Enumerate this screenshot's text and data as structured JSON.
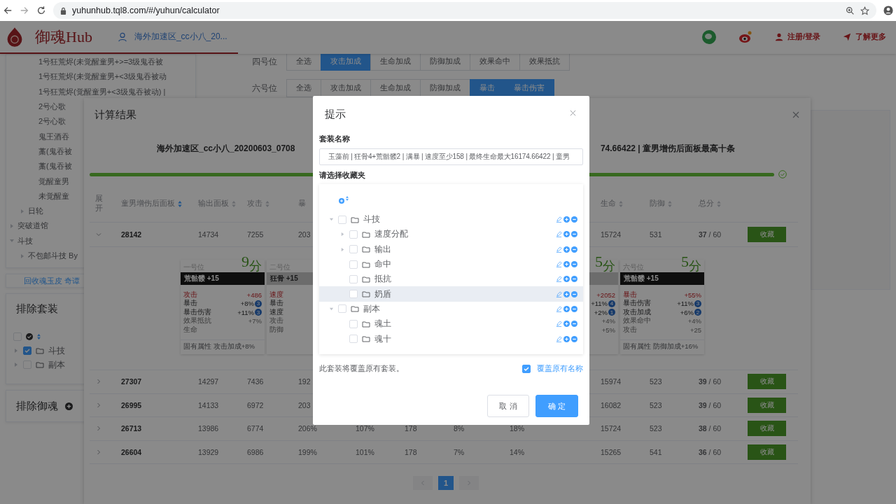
{
  "browser": {
    "url": "yuhunhub.tql8.com/#/yuhun/calculator"
  },
  "header": {
    "brand": "御魂Hub",
    "user": "海外加速区_cc小八_20...",
    "links": [
      {
        "kind": "wechat"
      },
      {
        "kind": "weibo"
      },
      {
        "kind": "user",
        "label": "注册/登录"
      },
      {
        "kind": "send",
        "label": "了解更多"
      }
    ]
  },
  "sidebar": {
    "tree": [
      {
        "children": [
          {
            "children": [
              {
                "label": "1号狂荒烬(未觉醒童男+>=3级鬼吞被"
              },
              {
                "label": "1号狂荒烬(未觉醒童男+<3级鬼吞被动"
              },
              {
                "label": "1号狂荒烬(觉醒童男+<3级鬼吞被动) |"
              },
              {
                "label": "2号心歌"
              },
              {
                "label": "2号心歌"
              },
              {
                "label": "鬼王酒吞"
              },
              {
                "label": "藁(鬼吞被"
              },
              {
                "label": "藁(鬼吞被"
              },
              {
                "label": "觉醒童男"
              },
              {
                "label": "未觉醒童"
              }
            ]
          },
          {
            "label": "日轮",
            "expanded": false
          }
        ]
      },
      {
        "label": "突破道馆",
        "expanded": false
      },
      {
        "label": "斗技",
        "expanded": true,
        "children": [
          {
            "label": "不包邮斗技 By",
            "expanded": false
          }
        ]
      }
    ],
    "link": "回收魂玉皮 奇谭",
    "exclude_sets": {
      "title": "排除套装",
      "all_checked": false,
      "folders": [
        {
          "label": "斗技",
          "checked": true
        },
        {
          "label": "副本",
          "checked": false
        }
      ]
    },
    "exclude_yuhun": {
      "title": "排除御魂"
    }
  },
  "filters": [
    {
      "label": "四号位",
      "options": [
        {
          "label": "全选",
          "selected": false
        },
        {
          "label": "攻击加成",
          "selected": true
        },
        {
          "label": "生命加成",
          "selected": false
        },
        {
          "label": "防御加成",
          "selected": false
        },
        {
          "label": "效果命中",
          "selected": false
        },
        {
          "label": "效果抵抗",
          "selected": false
        }
      ]
    },
    {
      "label": "六号位",
      "options": [
        {
          "label": "全选",
          "selected": false
        },
        {
          "label": "攻击加成",
          "selected": false
        },
        {
          "label": "生命加成",
          "selected": false
        },
        {
          "label": "防御加成",
          "selected": false
        },
        {
          "label": "暴击",
          "selected": true
        },
        {
          "label": "暴击伤害",
          "selected": true
        }
      ]
    }
  ],
  "result": {
    "title": "计算结果",
    "heading_left": "海外加速区_cc小八_20200603_0708",
    "heading_right": "74.66422 | 童男增伤后面板最高十条",
    "progress": {
      "level": 1
    },
    "columns": [
      {
        "label": "展开"
      },
      {
        "label": "童男增伤后面板",
        "sorted": true
      },
      {
        "label": "输出面板",
        "sorted": false
      },
      {
        "label": "攻击",
        "sorted": false
      },
      {
        "label": "暴"
      },
      null,
      null,
      null,
      null,
      {
        "label": "生命",
        "sorted": false
      },
      {
        "label": "防御",
        "sorted": false
      },
      {
        "label": "总分",
        "sorted": false
      },
      null
    ],
    "rows": [
      {
        "expanded": true,
        "cells": [
          null,
          "28142",
          "14734",
          "7255",
          "203",
          null,
          null,
          null,
          null,
          "15724",
          "531",
          "**37** / 60"
        ],
        "action": "收藏"
      },
      {
        "expanded": false,
        "cells": [
          null,
          "27307",
          "14297",
          "7436",
          "192",
          null,
          null,
          null,
          null,
          "15974",
          "523",
          "**39** / 60"
        ],
        "action": "收藏"
      },
      {
        "expanded": false,
        "cells": [
          null,
          "26995",
          "14133",
          "6972",
          "203",
          null,
          null,
          null,
          null,
          "16082",
          "523",
          "**39** / 60"
        ],
        "action": "收藏"
      },
      {
        "expanded": false,
        "cells": [
          null,
          "26713",
          "13986",
          "6774",
          "206%",
          "107%",
          "178",
          "8%",
          "18%",
          "15724",
          "523",
          "**38** / 60"
        ],
        "action": "收藏"
      },
      {
        "expanded": false,
        "cells": [
          null,
          "26604",
          "13929",
          "6986",
          "199%",
          "101%",
          "178",
          "7%",
          "14%",
          "15265",
          "541",
          "**36** / 60"
        ],
        "action": "收藏"
      }
    ],
    "cards_left": [
      {
        "slot": "一号位",
        "score": "9$_{分}$",
        "name": "荒骷髅 +15",
        "dark": true,
        "stats": [
          {
            "kind": "main",
            "label": "攻击",
            "value": "+486"
          },
          {
            "kind": "sub",
            "label": "暴击",
            "value": "+8%",
            "badge": "3"
          },
          {
            "kind": "sub",
            "label": "暴击伤害",
            "value": "+11%",
            "badge": "3"
          },
          {
            "kind": "faded",
            "label": "效果抵抗",
            "value": "+7%"
          },
          {
            "kind": "faded",
            "label": "生命"
          }
        ],
        "inherent": "固有属性 攻击加成+8%"
      },
      {
        "slot": "二号位",
        "name": "狂骨 +15",
        "dark": false,
        "stats": [
          {
            "kind": "main",
            "label": "速度"
          },
          {
            "kind": "sub",
            "label": "暴击"
          },
          {
            "kind": "sub",
            "label": "速度"
          },
          {
            "kind": "faded",
            "label": "攻击"
          },
          {
            "kind": "faded",
            "label": "防御"
          }
        ]
      }
    ],
    "cards_right": [
      {
        "score": "5$_{分}$",
        "dark": false,
        "stats": [
          {
            "kind": "main",
            "value": "+2052"
          },
          {
            "kind": "sub",
            "value": "+11%",
            "badge": "4"
          },
          {
            "kind": "sub",
            "value": "+2%",
            "badge": "1"
          },
          {
            "kind": "faded",
            "value": "+4%"
          },
          {
            "kind": "faded",
            "value": "+5%"
          }
        ]
      },
      {
        "slot": "六号位",
        "score": "5$_{分}$",
        "name": "荒骷髅 +15",
        "dark": true,
        "stats": [
          {
            "kind": "main",
            "label": "暴击",
            "value": "+55%"
          },
          {
            "kind": "sub",
            "label": "暴击伤害",
            "value": "+11%",
            "badge": "3"
          },
          {
            "kind": "sub",
            "label": "攻击加成",
            "value": "+6%",
            "badge": "2"
          },
          {
            "kind": "faded",
            "label": "效果命中",
            "value": "+4%"
          },
          {
            "kind": "faded",
            "label": "攻击",
            "value": "+25"
          }
        ],
        "inherent": "固有属性 防御加成+16%"
      }
    ],
    "pages": [
      {
        "label": "1",
        "selected": true
      }
    ]
  },
  "dialog": {
    "title": "提示",
    "name_label": "套装名称",
    "name_value": "玉藻前 | 狂骨4+荒骷髅2 | 满暴 | 速度至少158 | 最终生命最大16174.66422 | 童男",
    "folder_label": "请选择收藏夹",
    "tree": [
      {
        "label": "斗技",
        "expanded": true,
        "checked": false,
        "hovered": false,
        "children": [
          {
            "label": "速度分配",
            "expanded": false,
            "checked": false,
            "hovered": false
          },
          {
            "label": "输出",
            "expanded": false,
            "checked": false,
            "hovered": false
          },
          {
            "label": "命中",
            "checked": false,
            "hovered": false
          },
          {
            "label": "抵抗",
            "checked": false,
            "hovered": false
          },
          {
            "label": "奶盾",
            "checked": false,
            "hovered": true
          }
        ]
      },
      {
        "label": "副本",
        "expanded": true,
        "checked": false,
        "hovered": false,
        "children": [
          {
            "label": "魂土",
            "checked": false,
            "hovered": false
          },
          {
            "label": "魂十",
            "checked": false,
            "hovered": false
          }
        ]
      }
    ],
    "note": "此套装将覆盖原有套装。",
    "overwrite": {
      "label": "覆盖原有名称",
      "checked": true
    },
    "buttons": [
      {
        "label": "取 消",
        "kind": "default"
      },
      {
        "label": "确 定",
        "kind": "primary"
      }
    ]
  }
}
